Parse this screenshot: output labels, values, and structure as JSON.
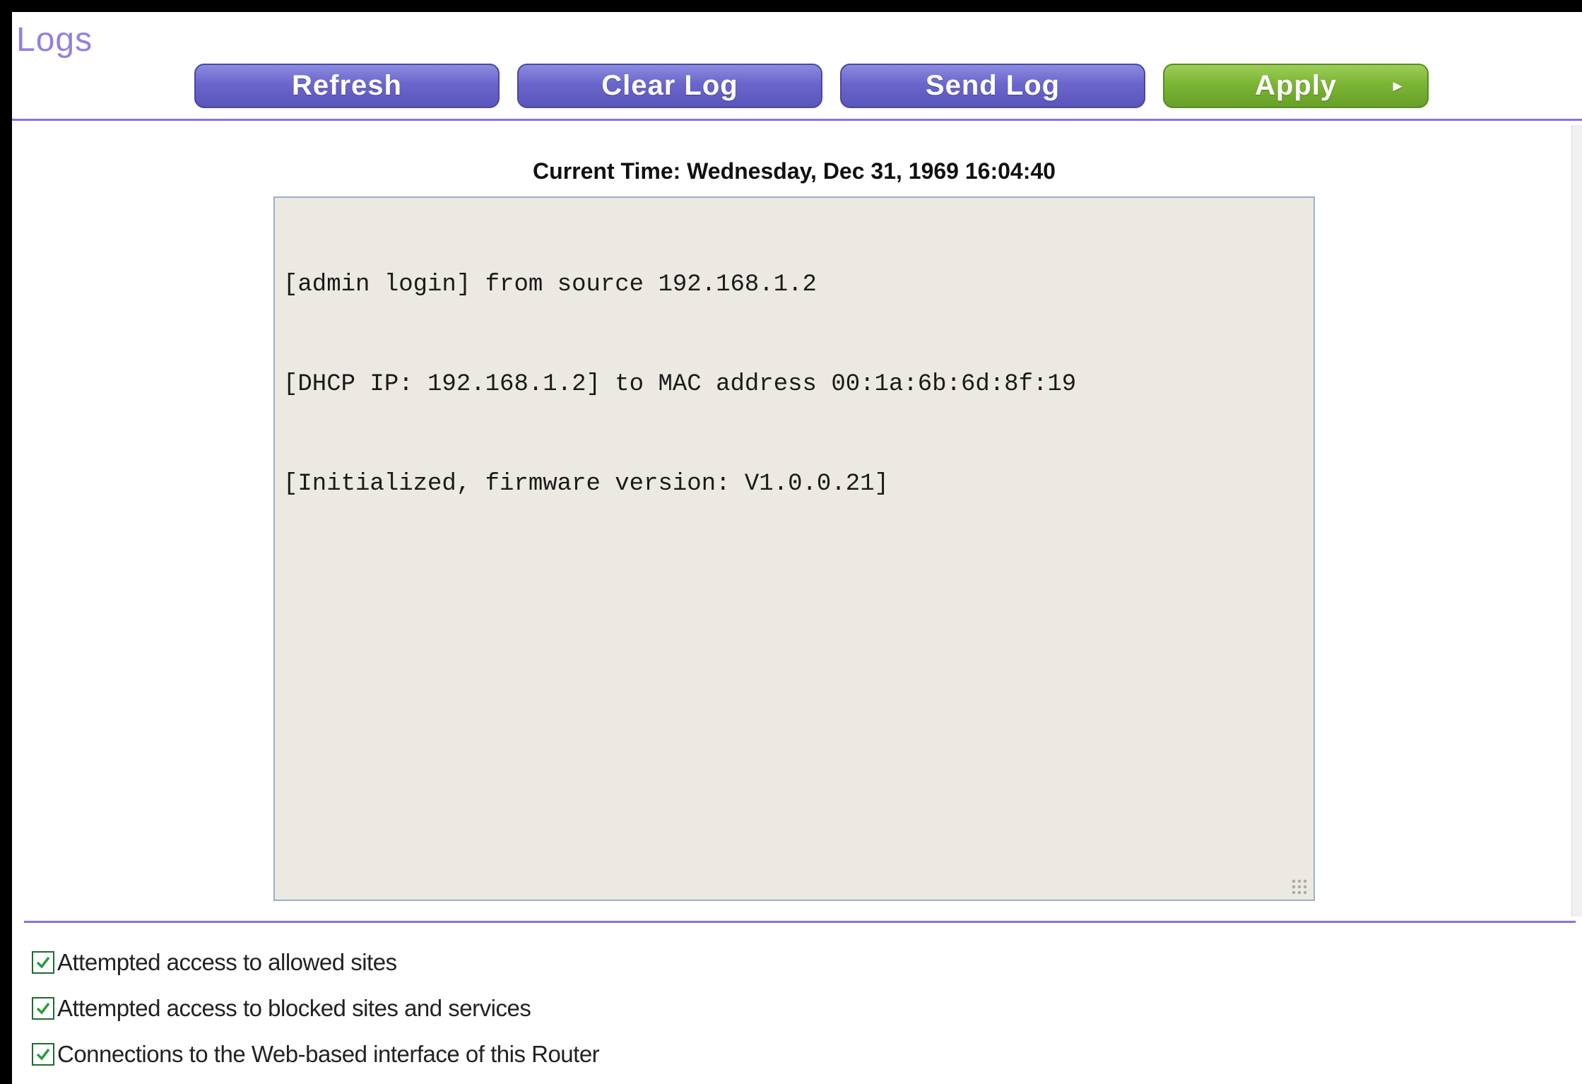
{
  "page": {
    "title": "Logs"
  },
  "toolbar": {
    "refresh_label": "Refresh",
    "clear_log_label": "Clear Log",
    "send_log_label": "Send Log",
    "apply_label": "Apply",
    "apply_arrow": "►"
  },
  "log": {
    "current_time": "Current Time: Wednesday, Dec 31, 1969 16:04:40",
    "entries": [
      "[admin login] from source 192.168.1.2",
      "[DHCP IP: 192.168.1.2] to MAC address 00:1a:6b:6d:8f:19",
      "[Initialized, firmware version: V1.0.0.21]"
    ]
  },
  "options": [
    {
      "label": "Attempted access to allowed sites",
      "checked": true
    },
    {
      "label": "Attempted access to blocked sites and services",
      "checked": true
    },
    {
      "label": "Connections to the Web-based interface of this Router",
      "checked": true
    },
    {
      "label": "",
      "checked": true
    }
  ],
  "colors": {
    "accent": "#8077e0",
    "button_purple": "#6a66cc",
    "button_green": "#7cb534",
    "title": "#8f82e0",
    "log_background": "#ebe9e1"
  },
  "icons": {
    "checkbox_check": "checkmark-icon",
    "apply_arrow": "play-arrow-icon",
    "resize": "resize-grip-icon"
  }
}
